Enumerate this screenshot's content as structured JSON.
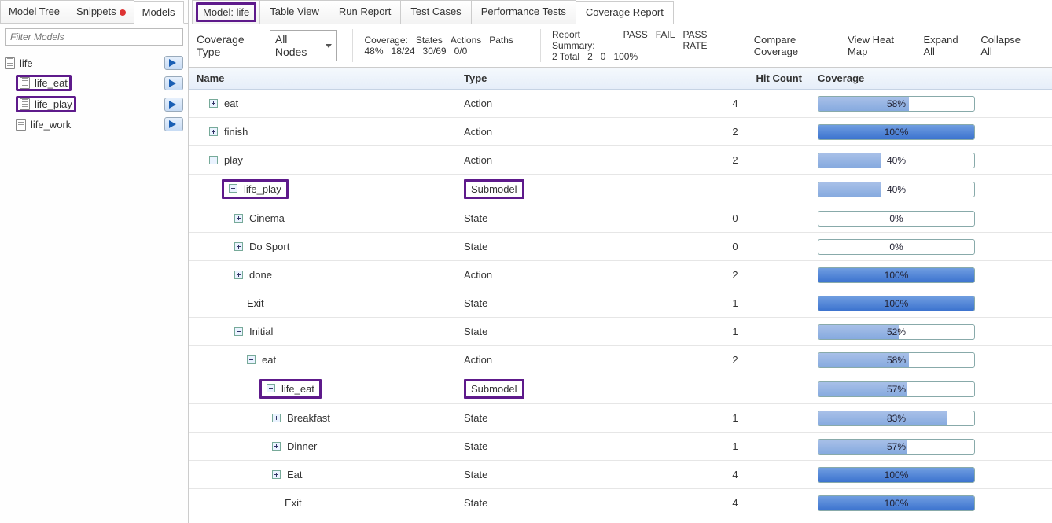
{
  "sidebar": {
    "tabs": [
      "Model Tree",
      "Snippets",
      "Models"
    ],
    "active_tab": 2,
    "filter_placeholder": "Filter Models",
    "items": [
      {
        "label": "life",
        "indent": 0,
        "highlight": false
      },
      {
        "label": "life_eat",
        "indent": 1,
        "highlight": true
      },
      {
        "label": "life_play",
        "indent": 1,
        "highlight": true
      },
      {
        "label": "life_work",
        "indent": 1,
        "highlight": false
      }
    ]
  },
  "main_tabs": {
    "items": [
      "Model: life",
      "Table View",
      "Run Report",
      "Test Cases",
      "Performance Tests",
      "Coverage Report"
    ],
    "active": 5,
    "highlight_first": true
  },
  "toolbar": {
    "coverage_type_label": "Coverage Type",
    "coverage_type_value": "All Nodes",
    "coverage_block": {
      "header": [
        "Coverage:",
        "States",
        "Actions",
        "Paths"
      ],
      "values": [
        "48%",
        "18/24",
        "30/69",
        "0/0"
      ]
    },
    "summary_block": {
      "header": [
        "Report Summary:",
        "PASS",
        "FAIL",
        "PASS RATE"
      ],
      "values": [
        "2 Total",
        "2",
        "0",
        "100%"
      ]
    },
    "buttons": [
      "Compare Coverage",
      "View Heat Map",
      "Expand All",
      "Collapse All"
    ]
  },
  "columns": [
    "Name",
    "Type",
    "Hit Count",
    "Coverage"
  ],
  "rows": [
    {
      "indent": 1,
      "toggle": "plus",
      "name": "eat",
      "type": "Action",
      "hit": "4",
      "cov": 58,
      "highlight_name": false,
      "highlight_type": false
    },
    {
      "indent": 1,
      "toggle": "plus",
      "name": "finish",
      "type": "Action",
      "hit": "2",
      "cov": 100,
      "highlight_name": false,
      "highlight_type": false
    },
    {
      "indent": 1,
      "toggle": "minus",
      "name": "play",
      "type": "Action",
      "hit": "2",
      "cov": 40,
      "highlight_name": false,
      "highlight_type": false
    },
    {
      "indent": 2,
      "toggle": "minus",
      "name": "life_play",
      "type": "Submodel",
      "hit": "",
      "cov": 40,
      "highlight_name": true,
      "highlight_type": true
    },
    {
      "indent": 3,
      "toggle": "plus",
      "name": "Cinema",
      "type": "State",
      "hit": "0",
      "cov": 0,
      "highlight_name": false,
      "highlight_type": false
    },
    {
      "indent": 3,
      "toggle": "plus",
      "name": "Do Sport",
      "type": "State",
      "hit": "0",
      "cov": 0,
      "highlight_name": false,
      "highlight_type": false
    },
    {
      "indent": 3,
      "toggle": "plus",
      "name": "done",
      "type": "Action",
      "hit": "2",
      "cov": 100,
      "highlight_name": false,
      "highlight_type": false
    },
    {
      "indent": 4,
      "toggle": "",
      "name": "Exit",
      "type": "State",
      "hit": "1",
      "cov": 100,
      "highlight_name": false,
      "highlight_type": false
    },
    {
      "indent": 3,
      "toggle": "minus",
      "name": "Initial",
      "type": "State",
      "hit": "1",
      "cov": 52,
      "highlight_name": false,
      "highlight_type": false
    },
    {
      "indent": 4,
      "toggle": "minus",
      "name": "eat",
      "type": "Action",
      "hit": "2",
      "cov": 58,
      "highlight_name": false,
      "highlight_type": false
    },
    {
      "indent": 5,
      "toggle": "minus",
      "name": "life_eat",
      "type": "Submodel",
      "hit": "",
      "cov": 57,
      "highlight_name": true,
      "highlight_type": true
    },
    {
      "indent": 6,
      "toggle": "plus",
      "name": "Breakfast",
      "type": "State",
      "hit": "1",
      "cov": 83,
      "highlight_name": false,
      "highlight_type": false
    },
    {
      "indent": 6,
      "toggle": "plus",
      "name": "Dinner",
      "type": "State",
      "hit": "1",
      "cov": 57,
      "highlight_name": false,
      "highlight_type": false
    },
    {
      "indent": 6,
      "toggle": "plus",
      "name": "Eat",
      "type": "State",
      "hit": "4",
      "cov": 100,
      "highlight_name": false,
      "highlight_type": false
    },
    {
      "indent": 7,
      "toggle": "",
      "name": "Exit",
      "type": "State",
      "hit": "4",
      "cov": 100,
      "highlight_name": false,
      "highlight_type": false
    }
  ]
}
